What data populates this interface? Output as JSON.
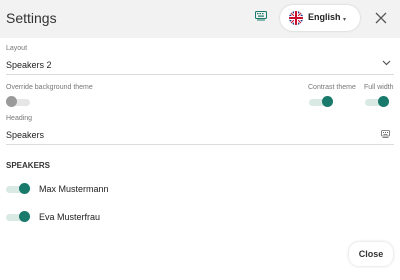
{
  "header": {
    "title": "Settings",
    "keyboard_icon": "keyboard-icon",
    "language": {
      "label": "English",
      "flag": "uk-flag-icon",
      "caret": "▾"
    },
    "close_icon": "close-icon"
  },
  "layout": {
    "label": "Layout",
    "value": "Speakers 2"
  },
  "options": {
    "override_background": {
      "label": "Override background theme",
      "on": false
    },
    "contrast_theme": {
      "label": "Contrast theme",
      "on": true
    },
    "full_width": {
      "label": "Full width",
      "on": true
    }
  },
  "heading": {
    "label": "Heading",
    "value": "Speakers"
  },
  "speakers": {
    "title": "SPEAKERS",
    "items": [
      {
        "name": "Max Mustermann",
        "on": true
      },
      {
        "name": "Eva Musterfrau",
        "on": true
      }
    ]
  },
  "footer": {
    "close_label": "Close"
  },
  "colors": {
    "accent": "#19796a",
    "header_bg": "#f2f2f2"
  }
}
